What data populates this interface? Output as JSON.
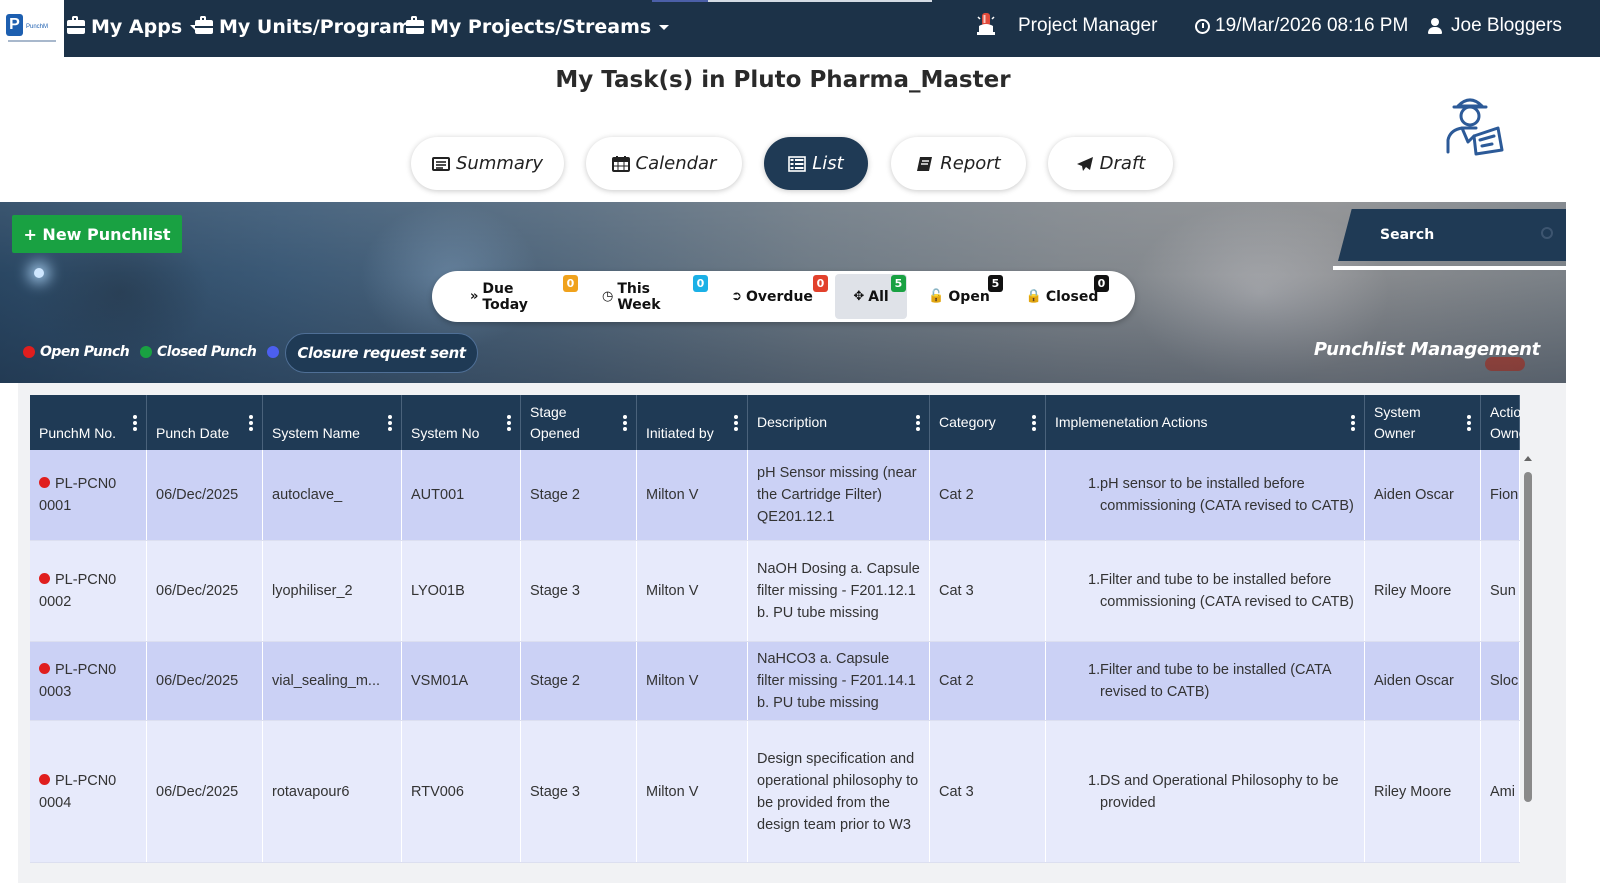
{
  "topbar": {
    "logo_text": "PunchM",
    "menus": [
      {
        "label": "My Apps",
        "caret": true
      },
      {
        "label": "My Units/Programs",
        "caret": false
      },
      {
        "label": "My Projects/Streams",
        "caret": true
      }
    ],
    "role": "Project Manager",
    "datetime": "19/Mar/2026 08:16 PM",
    "user": "Joe Bloggers"
  },
  "page_title": "My Task(s) in Pluto Pharma_Master",
  "view_tabs": [
    {
      "label": "Summary",
      "icon": "summary-icon",
      "active": false
    },
    {
      "label": "Calendar",
      "icon": "calendar-icon",
      "active": false
    },
    {
      "label": "List",
      "icon": "list-icon",
      "active": true
    },
    {
      "label": "Report",
      "icon": "report-icon",
      "active": false
    },
    {
      "label": "Draft",
      "icon": "send-icon",
      "active": false
    }
  ],
  "banner": {
    "new_button": "+ New Punchlist",
    "search_placeholder": "Search",
    "filters": [
      {
        "label": "Due Today",
        "icon": "chevrons-down-icon",
        "count": "0",
        "color": "#f0a21c"
      },
      {
        "label": "This Week",
        "icon": "clock-circle-icon",
        "count": "0",
        "color": "#1bb0e6"
      },
      {
        "label": "Overdue",
        "icon": "arrow-circle-icon",
        "count": "0",
        "color": "#e2412c"
      },
      {
        "label": "All",
        "icon": "move-icon",
        "count": "5",
        "color": "#19a142"
      },
      {
        "label": "Open",
        "icon": "unlock-icon",
        "count": "5",
        "color": "#111111"
      },
      {
        "label": "Closed",
        "icon": "lock-icon",
        "count": "0",
        "color": "#111111"
      }
    ],
    "legend": {
      "open": "Open Punch",
      "closed": "Closed Punch",
      "closure": "Closure request sent"
    },
    "legend_colors": {
      "open": "#e01e1e",
      "closed": "#19a142",
      "closure": "#4c5ff0"
    },
    "management_label": "Punchlist Management"
  },
  "table": {
    "columns": [
      {
        "label": "PunchM No.",
        "menu": true
      },
      {
        "label": "Punch Date",
        "menu": true
      },
      {
        "label": "System Name",
        "menu": true
      },
      {
        "label": "System No",
        "menu": true
      },
      {
        "label": "Stage Opened",
        "menu": true
      },
      {
        "label": "Initiated by",
        "menu": true
      },
      {
        "label": "Description",
        "menu": true
      },
      {
        "label": "Category",
        "menu": true
      },
      {
        "label": "Implemenetation Actions",
        "menu": true
      },
      {
        "label": "System Owner",
        "menu": true
      },
      {
        "label": "Action Owner",
        "menu": false
      }
    ],
    "rows": [
      {
        "punch_no": "PL-PCN00001",
        "date": "06/Dec/2025",
        "system_name": "autoclave_",
        "system_no": "AUT001",
        "stage": "Stage 2",
        "initiated_by": "Milton V",
        "description": "pH Sensor missing (near the Cartridge Filter) QE201.12.1",
        "category": "Cat 2",
        "action_num": "1.",
        "action": "pH sensor to be installed before commissioning (CATA revised to CATB)",
        "system_owner": "Aiden Oscar",
        "action_owner": "Fion"
      },
      {
        "punch_no": "PL-PCN00002",
        "date": "06/Dec/2025",
        "system_name": "lyophiliser_2",
        "system_no": "LYO01B",
        "stage": "Stage 3",
        "initiated_by": "Milton V",
        "description": "NaOH Dosing a. Capsule filter missing - F201.12.1 b. PU tube missing",
        "category": "Cat 3",
        "action_num": "1.",
        "action": "Filter and tube to be installed before commissioning (CATA revised to CATB)",
        "system_owner": "Riley Moore",
        "action_owner": "Sun"
      },
      {
        "punch_no": "PL-PCN00003",
        "date": "06/Dec/2025",
        "system_name": "vial_sealing_m...",
        "system_no": "VSM01A",
        "stage": "Stage 2",
        "initiated_by": "Milton V",
        "description": "NaHCO3 a. Capsule filter missing - F201.14.1 b. PU tube missing",
        "category": "Cat 2",
        "action_num": "1.",
        "action": "Filter and tube to be installed (CATA revised to CATB)",
        "system_owner": "Aiden Oscar",
        "action_owner": "Sloc"
      },
      {
        "punch_no": "PL-PCN00004",
        "date": "06/Dec/2025",
        "system_name": "rotavapour6",
        "system_no": "RTV006",
        "stage": "Stage 3",
        "initiated_by": "Milton V",
        "description": "Design specification and operational philosophy to be provided from the design team prior to W3",
        "category": "Cat 3",
        "action_num": "1.",
        "action": "DS and Operational Philosophy to be provided",
        "system_owner": "Riley Moore",
        "action_owner": "Ami"
      }
    ]
  },
  "colors": {
    "topbar_bg": "#1c3248",
    "header_bg": "#1f3a55",
    "new_button": "#19a142",
    "row_odd": "#cbd1f5",
    "row_even": "#e7eafb",
    "open_dot": "#e01e1e"
  }
}
